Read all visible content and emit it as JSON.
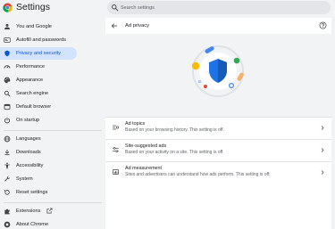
{
  "app": {
    "title": "Settings",
    "search_placeholder": "Search settings"
  },
  "sidebar": {
    "items": [
      {
        "label": "You and Google",
        "icon": "person-icon"
      },
      {
        "label": "Autofill and passwords",
        "icon": "autofill-icon"
      },
      {
        "label": "Privacy and security",
        "icon": "shield-icon",
        "active": true
      },
      {
        "label": "Performance",
        "icon": "speedometer-icon"
      },
      {
        "label": "Appearance",
        "icon": "palette-icon"
      },
      {
        "label": "Search engine",
        "icon": "search-icon"
      },
      {
        "label": "Default browser",
        "icon": "browser-icon"
      },
      {
        "label": "On startup",
        "icon": "power-icon"
      },
      {
        "label": "Languages",
        "icon": "globe-icon"
      },
      {
        "label": "Downloads",
        "icon": "download-icon"
      },
      {
        "label": "Accessibility",
        "icon": "accessibility-icon"
      },
      {
        "label": "System",
        "icon": "wrench-icon"
      },
      {
        "label": "Reset settings",
        "icon": "reset-icon"
      },
      {
        "label": "Extensions",
        "icon": "puzzle-icon"
      },
      {
        "label": "About Chrome",
        "icon": "chrome-icon"
      }
    ]
  },
  "panel": {
    "title": "Ad privacy",
    "rows": [
      {
        "title": "Ad topics",
        "description": "Based on your browsing history. This setting is off.",
        "icon": "ad-topics-icon"
      },
      {
        "title": "Site-suggested ads",
        "description": "Based on your activity on a site. This setting is off.",
        "icon": "site-ads-icon"
      },
      {
        "title": "Ad measurement",
        "description": "Sites and advertisers can understand how ads perform. This setting is off.",
        "icon": "ad-measurement-icon"
      }
    ]
  },
  "colors": {
    "accent": "#0b57d0",
    "active_bg": "#d3e3fd",
    "background": "#f1f3f4",
    "panel": "#ffffff"
  }
}
